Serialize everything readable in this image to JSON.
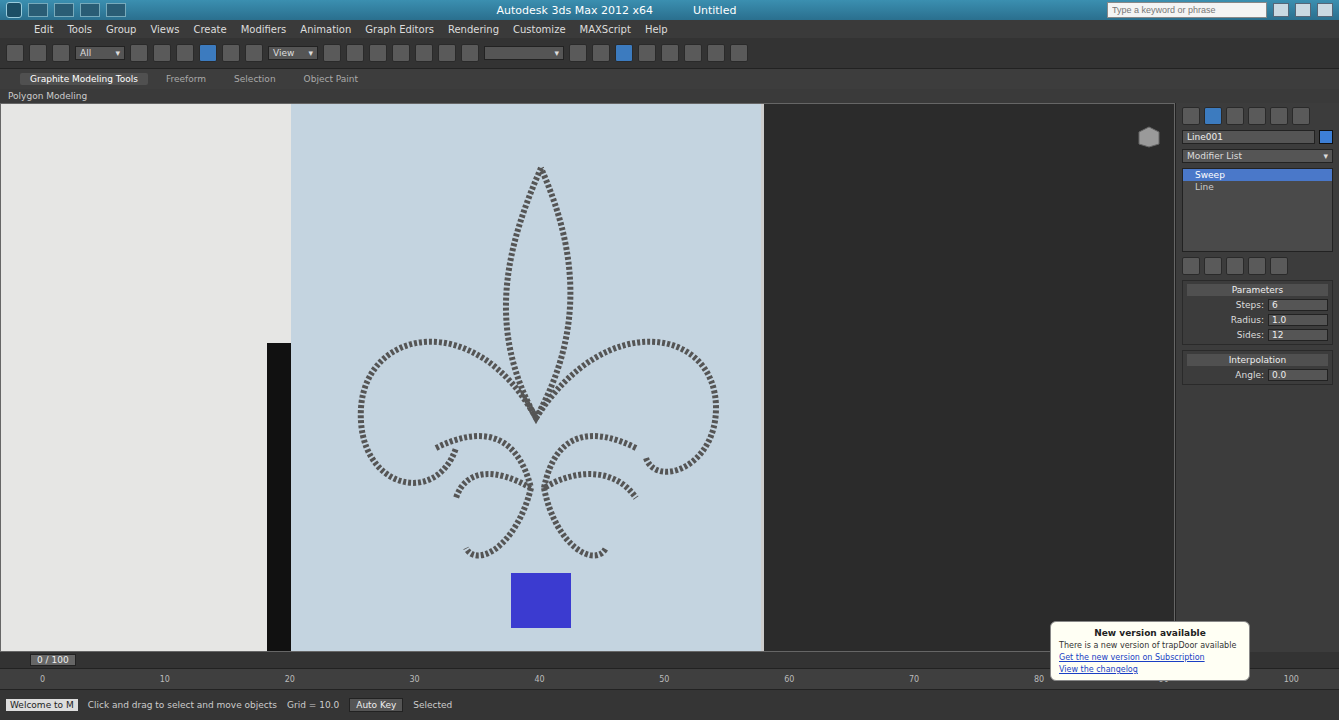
{
  "window": {
    "title": "Autodesk 3ds Max 2012 x64",
    "document": "Untitled"
  },
  "search": {
    "placeholder": "Type a keyword or phrase"
  },
  "menu": [
    "Edit",
    "Tools",
    "Group",
    "Views",
    "Create",
    "Modifiers",
    "Animation",
    "Graph Editors",
    "Rendering",
    "Customize",
    "MAXScript",
    "Help"
  ],
  "toolbar": {
    "filter": "All",
    "reference": "View"
  },
  "ribbon_tabs": [
    {
      "label": "Graphite Modeling Tools",
      "selected": true
    },
    {
      "label": "Freeform",
      "selected": false
    },
    {
      "label": "Selection",
      "selected": false
    },
    {
      "label": "Object Paint",
      "selected": false
    }
  ],
  "ribbon_label": "Polygon Modeling",
  "command_panel": {
    "object_name": "Line001",
    "modifier_list": "Modifier List",
    "stack": [
      {
        "label": "Sweep",
        "selected": true
      },
      {
        "label": "Line",
        "selected": false
      }
    ],
    "rollouts": [
      {
        "title": "Parameters",
        "fields": [
          {
            "label": "Steps:",
            "value": "6"
          },
          {
            "label": "Radius:",
            "value": "1.0"
          },
          {
            "label": "Sides:",
            "value": "12"
          }
        ]
      },
      {
        "title": "Interpolation",
        "fields": [
          {
            "label": "Angle:",
            "value": "0.0"
          }
        ]
      }
    ]
  },
  "timeline": {
    "frame": "0 / 100",
    "ticks": [
      "0",
      "10",
      "20",
      "30",
      "40",
      "50",
      "60",
      "70",
      "80",
      "90",
      "100"
    ]
  },
  "status": {
    "prompt": "Welcome to M",
    "message": "Click and drag to select and move objects",
    "grid": "Grid = 10.0",
    "autokey": "Auto Key",
    "selected": "Selected"
  },
  "notification": {
    "title": "New version available",
    "body": "There is a new version of trapDoor available",
    "links": [
      "Get the new version on Subscription",
      "View the changelog"
    ]
  }
}
